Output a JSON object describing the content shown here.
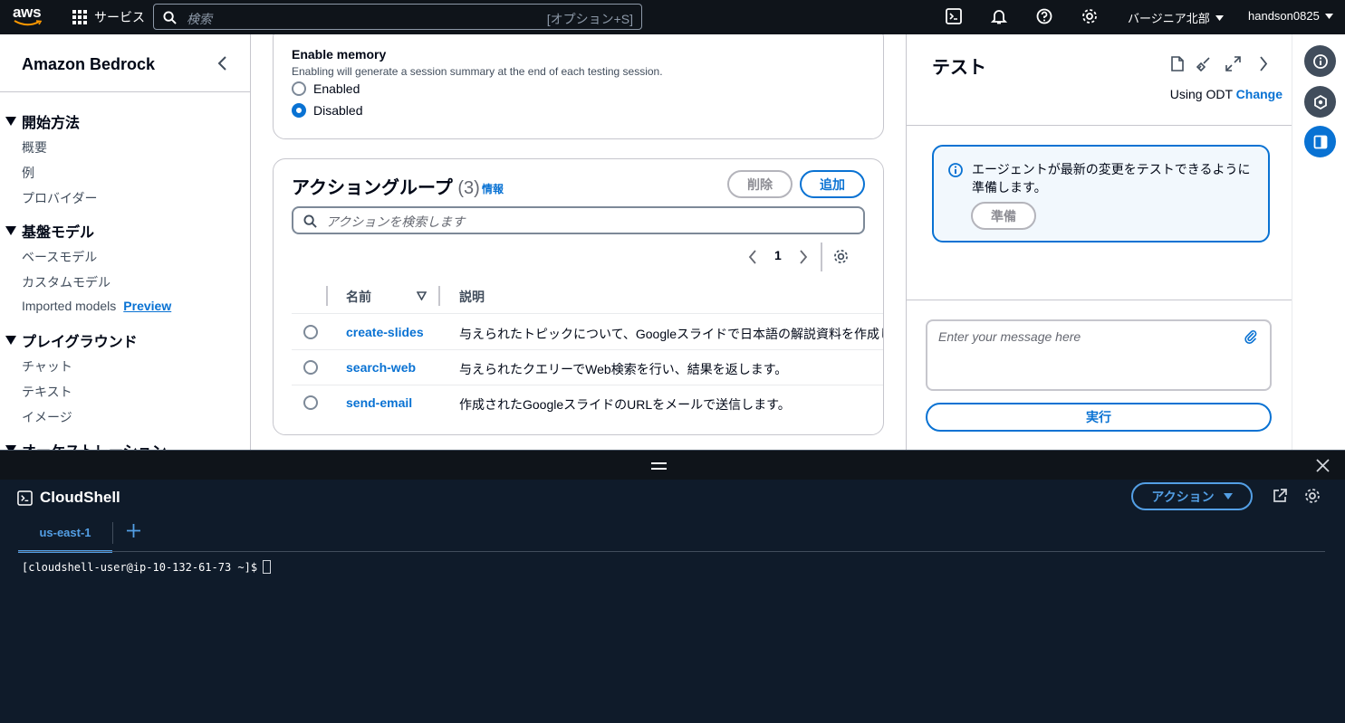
{
  "topbar": {
    "logo_text": "aws",
    "services_label": "サービス",
    "search_placeholder": "検索",
    "search_shortcut": "[オプション+S]",
    "region": "バージニア北部",
    "user": "handson0825"
  },
  "sidenav": {
    "title": "Amazon Bedrock",
    "sections": [
      {
        "label": "開始方法",
        "items": [
          "概要",
          "例",
          "プロバイダー"
        ]
      },
      {
        "label": "基盤モデル",
        "items": [
          "ベースモデル",
          "カスタムモデル",
          "Imported models"
        ],
        "badge": "Preview"
      },
      {
        "label": "プレイグラウンド",
        "items": [
          "チャット",
          "テキスト",
          "イメージ"
        ]
      },
      {
        "label": "オーケストレーション",
        "items": []
      }
    ]
  },
  "memory": {
    "title": "Enable memory",
    "description": "Enabling will generate a session summary at the end of each testing session.",
    "options": [
      "Enabled",
      "Disabled"
    ],
    "selected": "Disabled"
  },
  "action_groups": {
    "title": "アクショングループ",
    "count": "(3)",
    "info": "情報",
    "delete_label": "削除",
    "add_label": "追加",
    "search_placeholder": "アクションを検索します",
    "page": "1",
    "columns": [
      "名前",
      "説明"
    ],
    "rows": [
      {
        "name": "create-slides",
        "description": "与えられたトピックについて、Googleスライドで日本語の解説資料を作成し"
      },
      {
        "name": "search-web",
        "description": "与えられたクエリーでWeb検索を行い、結果を返します。"
      },
      {
        "name": "send-email",
        "description": "作成されたGoogleスライドのURLをメールで送信します。"
      }
    ]
  },
  "test_panel": {
    "title": "テスト",
    "using_prefix": "Using ODT",
    "change_link": "Change",
    "alert_message": "エージェントが最新の変更をテストできるように準備します。",
    "prepare_label": "準備",
    "message_placeholder": "Enter your message here",
    "run_label": "実行"
  },
  "cloudshell": {
    "title": "CloudShell",
    "actions_label": "アクション",
    "tab": "us-east-1",
    "prompt": "[cloudshell-user@ip-10-132-61-73 ~]$"
  },
  "colors": {
    "accent": "#0972d3",
    "topbar_bg": "#0f141a",
    "cloudshell_bg": "#0f1b2a",
    "cloudshell_accent": "#539fe5"
  }
}
